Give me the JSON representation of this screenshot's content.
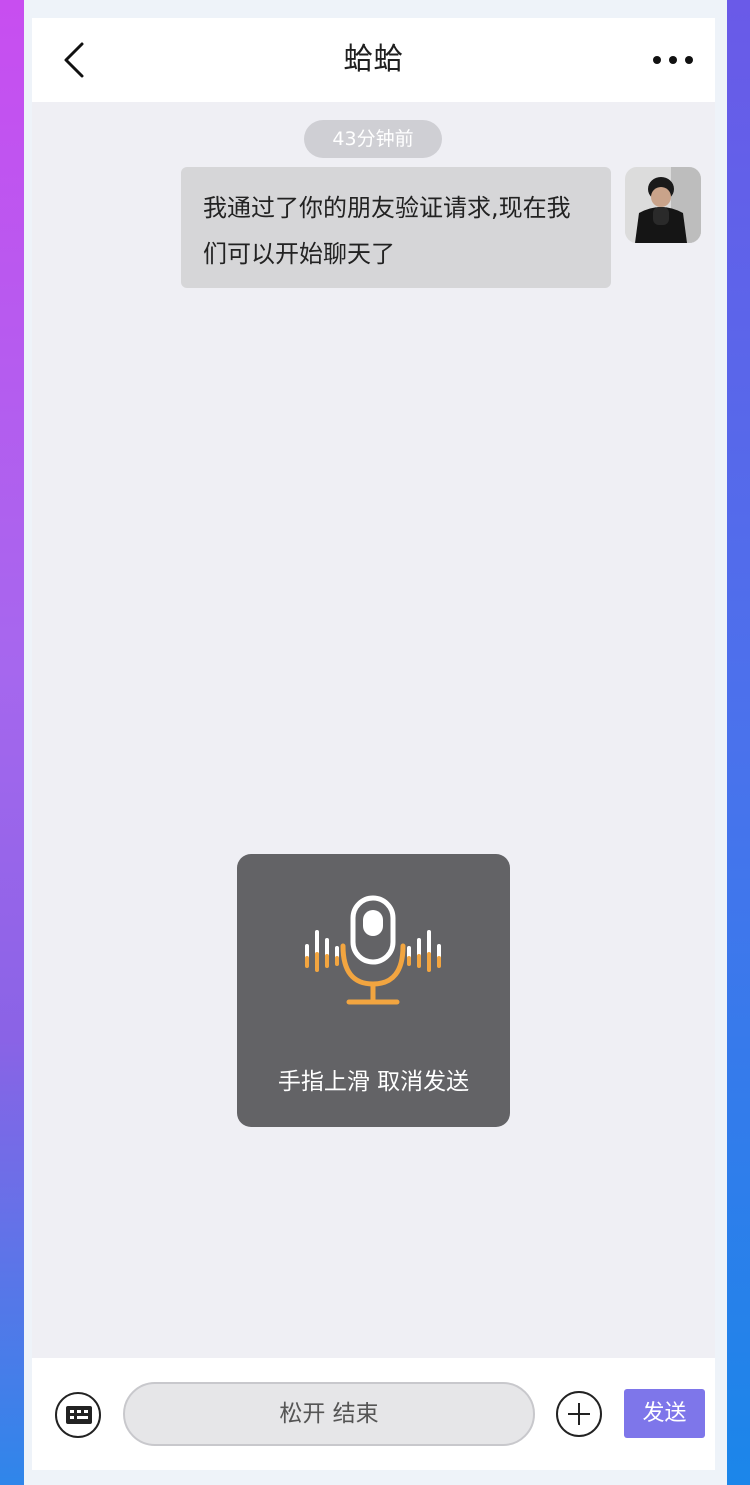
{
  "header": {
    "title": "蛤蛤"
  },
  "chat": {
    "timestamp": "43分钟前",
    "messages": [
      {
        "sender": "self",
        "text": "我通过了你的朋友验证请求,现在我们可以开始聊天了"
      }
    ]
  },
  "voice_overlay": {
    "hint": "手指上滑 取消发送"
  },
  "input_bar": {
    "hold_button_label": "松开 结束",
    "send_label": "发送"
  },
  "colors": {
    "accent": "#7e76ea",
    "mic_orange": "#f2a540"
  }
}
